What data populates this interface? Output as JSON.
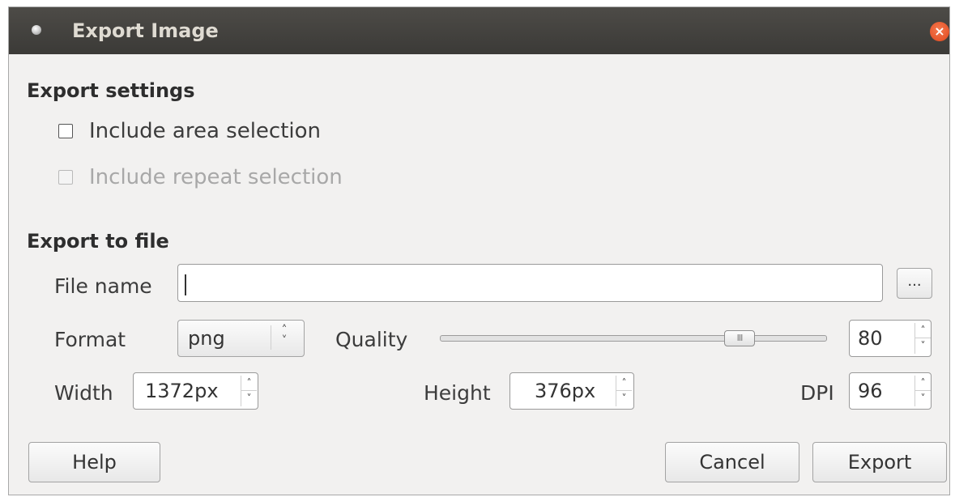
{
  "window": {
    "title": "Export Image",
    "close_symbol": "×"
  },
  "export_settings": {
    "heading": "Export settings",
    "include_area_selection": {
      "label": "Include area selection",
      "checked": false,
      "enabled": true
    },
    "include_repeat_selection": {
      "label": "Include repeat selection",
      "checked": false,
      "enabled": false
    }
  },
  "export_to_file": {
    "heading": "Export to file",
    "file_name": {
      "label": "File name",
      "value": ""
    },
    "browse_label": "...",
    "format": {
      "label": "Format",
      "value": "png"
    },
    "quality": {
      "label": "Quality",
      "value": "80",
      "slider_fraction": 0.8
    },
    "width": {
      "label": "Width",
      "value": "1372px"
    },
    "height": {
      "label": "Height",
      "value": "376px"
    },
    "dpi": {
      "label": "DPI",
      "value": "96"
    }
  },
  "buttons": {
    "help": "Help",
    "cancel": "Cancel",
    "export": "Export"
  },
  "icons": {
    "up_arrow": "˄",
    "down_arrow": "˅",
    "slider_grip": "III"
  },
  "colors": {
    "titlebar": "#3c3b37",
    "close": "#e8542a",
    "dialog_bg": "#f2f1f0"
  }
}
